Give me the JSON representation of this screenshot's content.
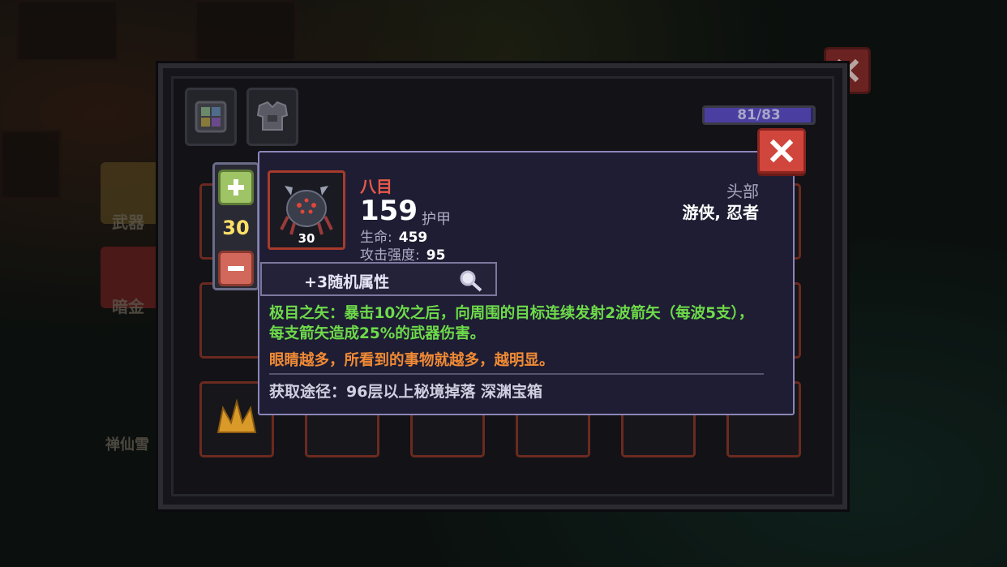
{
  "background": {
    "weapon_label": "武器",
    "gold_label": "暗金",
    "npc_label": "禅仙雪"
  },
  "window": {
    "capacity_text": "81/83",
    "capacity_fraction": 0.976,
    "tabs": [
      {
        "icon": "gem-grid-icon"
      },
      {
        "icon": "armor-icon"
      }
    ]
  },
  "stepper": {
    "value": "30",
    "plus_icon": "plus-icon",
    "minus_icon": "minus-icon"
  },
  "item": {
    "name": "八目",
    "level": "30",
    "armor_value": "159",
    "armor_label": "护甲",
    "stats": [
      {
        "label": "生命:",
        "value": "459"
      },
      {
        "label": "攻击强度:",
        "value": "95"
      }
    ],
    "slot": "头部",
    "classes": "游侠, 忍者",
    "random_attrs": "+3随机属性",
    "effect": "极目之矢：暴击10次之后，向周围的目标连续发射2波箭矢（每波5支），每支箭矢造成25%的武器伤害。",
    "flavor": "眼睛越多，所看到的事物就越多，越明显。",
    "source": "获取途径：96层以上秘境掉落 深渊宝箱"
  },
  "colors": {
    "item_name": "#e95a4a",
    "effect": "#6edb4a",
    "flavor": "#f08a35",
    "close_button": "#d1463c",
    "level_value": "#ffe067"
  }
}
